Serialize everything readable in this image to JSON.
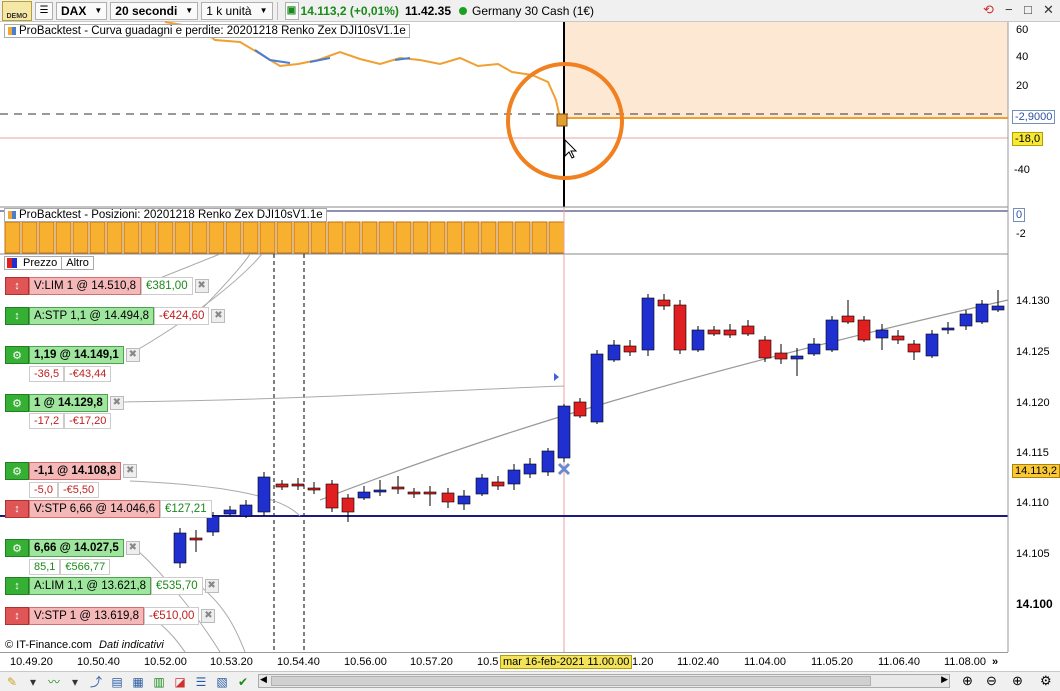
{
  "toolbar": {
    "demo_label": "DEMO",
    "instrument_select": "DAX",
    "timeframe_select": "20 secondi",
    "units_select": "1 k unità",
    "last_price": "14.113,2 (+0,01%)",
    "time": "11.42.35",
    "instrument_name": "Germany 30 Cash (1€)"
  },
  "equity_panel": {
    "label": "ProBacktest - Curva guadagni e perdite: 20201218 Renko Zex DJI10sV1.1e",
    "axis_labels": [
      "60",
      "40",
      "20",
      "-40"
    ],
    "value_tag": "-2,9000",
    "level_tag": "-18,0"
  },
  "positions_panel": {
    "label": "ProBacktest - Posizioni: 20201218 Renko Zex DJI10sV1.1e",
    "axis_labels": [
      "0",
      "-2"
    ]
  },
  "price_panel": {
    "tabs": [
      "Prezzo",
      "Altro"
    ],
    "axis_labels": [
      "14.130",
      "14.125",
      "14.120",
      "14.115",
      "14.110",
      "14.105",
      "14.100"
    ],
    "price_tag": "14.113,2",
    "watermark_source": "© IT-Finance.com",
    "watermark_note": "Dati indicativi",
    "orders": [
      {
        "label": "V:LIM  1 @ 14.510,8",
        "pnl": "€381,00",
        "pnl_color": "#1a8a1a"
      },
      {
        "label": "A:STP  1,1 @ 14.494,8",
        "pnl": "-€424,60",
        "pnl_color": "#c02020"
      },
      {
        "label": "1,19 @ 14.149,1",
        "sub": [
          "-36,5",
          "-€43,44"
        ],
        "sub_color": "#c02020"
      },
      {
        "label": "1 @ 14.129,8",
        "sub": [
          "-17,2",
          "-€17,20"
        ],
        "sub_color": "#c02020"
      },
      {
        "label": "-1,1 @ 14.108,8",
        "sub": [
          "-5,0",
          "-€5,50"
        ],
        "sub_color": "#c02020"
      },
      {
        "label": "V:STP  6,66 @ 14.046,6",
        "pnl": "€127,21",
        "pnl_color": "#1a8a1a"
      },
      {
        "label": "6,66 @ 14.027,5",
        "sub": [
          "85,1",
          "€566,77"
        ],
        "sub_color": "#1a8a1a"
      },
      {
        "label": "A:LIM  1,1 @ 13.621,8",
        "pnl": "€535,70",
        "pnl_color": "#1a8a1a"
      },
      {
        "label": "V:STP  1 @ 13.619,8",
        "pnl": "-€510,00",
        "pnl_color": "#c02020"
      }
    ]
  },
  "time_axis": {
    "labels": [
      "10.49.20",
      "10.50.40",
      "10.52.00",
      "10.53.20",
      "10.54.40",
      "10.56.00",
      "10.57.20",
      "10.5",
      "1.20",
      "11.02.40",
      "11.04.00",
      "11.05.20",
      "11.06.40",
      "11.08.00"
    ],
    "cursor_label": "mar 16-feb-2021 11.00.00"
  },
  "colors": {
    "up_candle": "#2030d0",
    "down_candle": "#e02020",
    "highlight_circle": "#f08020",
    "equity_fill": "#fde9d3"
  }
}
